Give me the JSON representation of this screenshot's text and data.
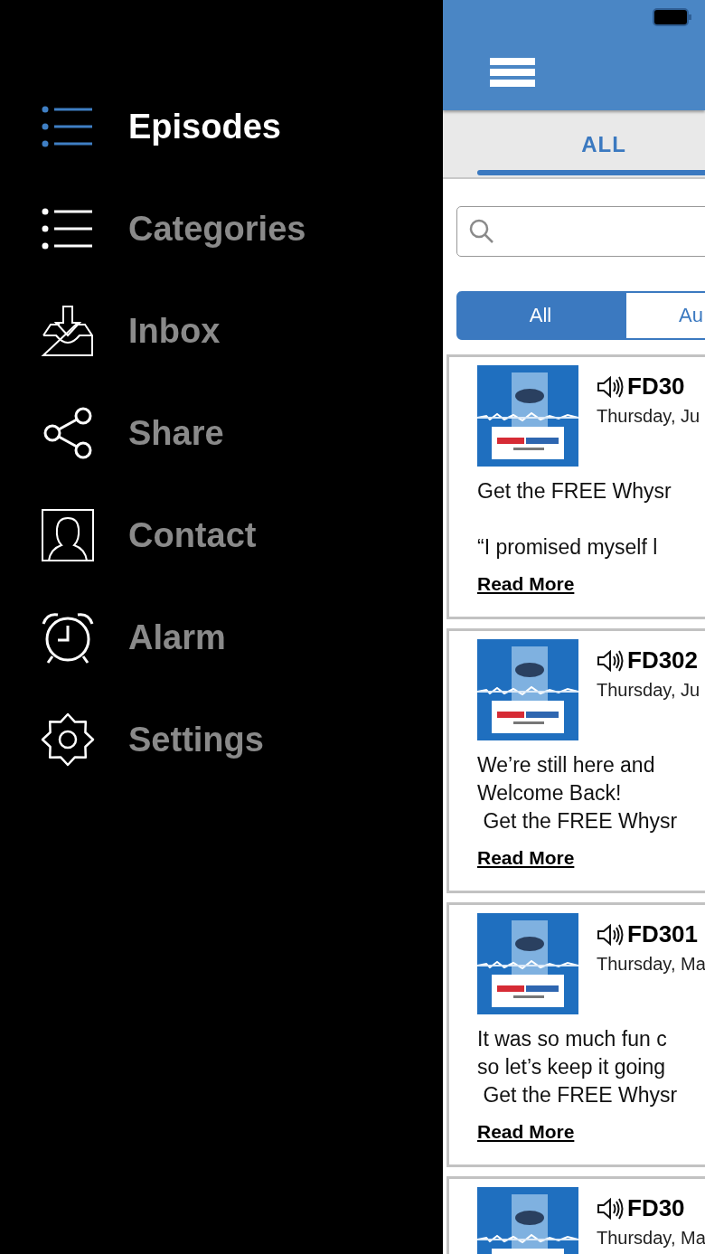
{
  "menu": {
    "items": [
      {
        "label": "Episodes",
        "kind": "list",
        "selected": true
      },
      {
        "label": "Categories",
        "kind": "list",
        "selected": false
      },
      {
        "label": "Inbox",
        "kind": "inbox",
        "selected": false
      },
      {
        "label": "Share",
        "kind": "share",
        "selected": false
      },
      {
        "label": "Contact",
        "kind": "contact",
        "selected": false
      },
      {
        "label": "Alarm",
        "kind": "alarm",
        "selected": false
      },
      {
        "label": "Settings",
        "kind": "settings",
        "selected": false
      }
    ]
  },
  "tabs": [
    {
      "label": "ALL",
      "selected": true
    }
  ],
  "filters": [
    {
      "label": "All",
      "selected": true
    },
    {
      "label": "Au",
      "selected": false
    }
  ],
  "episodes": [
    {
      "artwork": {
        "kind": "picture"
      },
      "title": "FD30",
      "date": "Thursday, Ju",
      "paragraphs": [
        "Get the FREE Whysr",
        "“I promised myself l"
      ],
      "link": "Read More"
    },
    {
      "artwork": {
        "kind": "picture"
      },
      "title": "FD302",
      "date": "Thursday, Ju",
      "paragraphs": [
        "We’re still here and\nWelcome Back!\n Get the FREE Whysr"
      ],
      "link": "Read More"
    },
    {
      "artwork": {
        "kind": "picture"
      },
      "title": "FD301",
      "date": "Thursday, Ma",
      "paragraphs": [
        "It was so much fun c\nso let’s keep it going\n Get the FREE Whysr"
      ],
      "link": "Read More"
    },
    {
      "artwork": {
        "kind": "picture"
      },
      "title": "FD30",
      "date": "Thursday, Ma"
    }
  ]
}
